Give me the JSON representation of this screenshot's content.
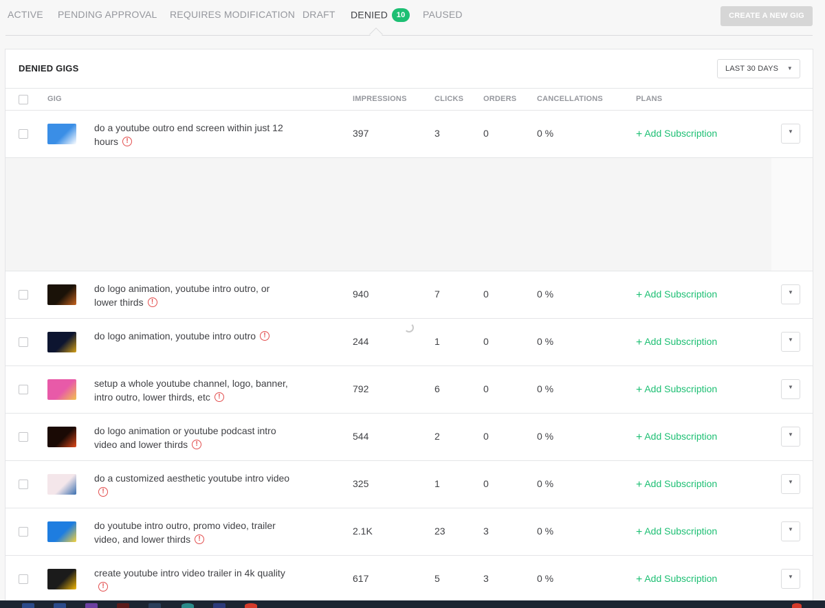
{
  "tabs": [
    {
      "label": "ACTIVE"
    },
    {
      "label": "PENDING APPROVAL"
    },
    {
      "label": "REQUIRES MODIFICATION"
    },
    {
      "label": "DRAFT"
    },
    {
      "label": "DENIED",
      "badge": "10",
      "active": true
    },
    {
      "label": "PAUSED"
    }
  ],
  "create_button": "CREATE A NEW GIG",
  "panel": {
    "title": "DENIED GIGS",
    "date_range": "LAST 30 DAYS"
  },
  "columns": {
    "gig": "GIG",
    "impressions": "IMPRESSIONS",
    "clicks": "CLICKS",
    "orders": "ORDERS",
    "cancellations": "CANCELLATIONS",
    "plans": "PLANS"
  },
  "action_label": "Add Subscription",
  "warn_glyph": "!",
  "menu_glyph": "▼",
  "gigs": [
    {
      "title": "do a youtube outro end screen within just 12 hours",
      "impressions": "397",
      "clicks": "3",
      "orders": "0",
      "cancellations": "0 %",
      "thumb_colors": [
        "#3a8ee6",
        "#ffffff"
      ]
    },
    {
      "title": "do logo animation, youtube intro outro, or lower thirds",
      "impressions": "940",
      "clicks": "7",
      "orders": "0",
      "cancellations": "0 %",
      "thumb_colors": [
        "#1a1208",
        "#c8641e"
      ]
    },
    {
      "title": "do logo animation, youtube intro outro",
      "impressions": "244",
      "clicks": "1",
      "orders": "0",
      "cancellations": "0 %",
      "thumb_colors": [
        "#0d1530",
        "#d4a017"
      ]
    },
    {
      "title": "setup a whole youtube channel, logo, banner, intro outro, lower thirds, etc",
      "impressions": "792",
      "clicks": "6",
      "orders": "0",
      "cancellations": "0 %",
      "thumb_colors": [
        "#e85aa8",
        "#f2c14e"
      ]
    },
    {
      "title": "do logo animation or youtube podcast intro video and lower thirds",
      "impressions": "544",
      "clicks": "2",
      "orders": "0",
      "cancellations": "0 %",
      "thumb_colors": [
        "#1a0a05",
        "#e04a1a"
      ]
    },
    {
      "title": "do a customized aesthetic youtube intro video",
      "impressions": "325",
      "clicks": "1",
      "orders": "0",
      "cancellations": "0 %",
      "thumb_colors": [
        "#f4e6ea",
        "#3a6fb0"
      ]
    },
    {
      "title": "do youtube intro outro, promo video, trailer video, and lower thirds",
      "impressions": "2.1K",
      "clicks": "23",
      "orders": "3",
      "cancellations": "0 %",
      "thumb_colors": [
        "#1e7de0",
        "#f5d23c"
      ]
    },
    {
      "title": "create youtube intro video trailer in 4k quality",
      "impressions": "617",
      "clicks": "5",
      "orders": "3",
      "cancellations": "0 %",
      "thumb_colors": [
        "#1b1b1b",
        "#f2b705"
      ]
    }
  ],
  "colors": {
    "accent": "#1dbf73",
    "warning": "#e24d4d",
    "muted": "#95979d"
  }
}
